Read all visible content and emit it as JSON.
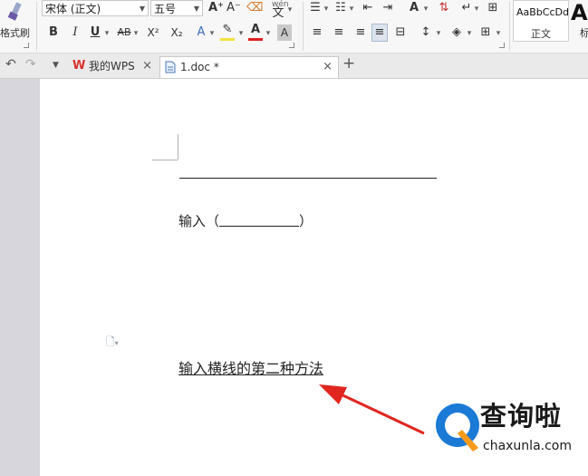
{
  "ribbon": {
    "format_painter_label": "格式刷",
    "font_name": "宋体 (正文)",
    "font_size": "五号",
    "grow_font": "A⁺",
    "shrink_font": "A⁻",
    "bold": "B",
    "italic": "I",
    "underline": "U",
    "strikethrough": "AB",
    "superscript": "X²",
    "subscript": "X₂",
    "pinyin_label": "wén",
    "style_preview": "AaBbCcDd",
    "style_name": "正文",
    "style2_preview": "A",
    "style2_name": "标"
  },
  "tabs": [
    {
      "label": "我的WPS",
      "close": "×"
    },
    {
      "label": "1.doc *",
      "close": "×"
    }
  ],
  "tabbar": {
    "new_tab": "+",
    "undo": "↶",
    "redo": "↷",
    "more": "▼"
  },
  "document": {
    "line1_prefix": "输入（",
    "line1_suffix": "）",
    "line2": "输入横线的第二种方法"
  },
  "watermark": {
    "cn": "查询啦",
    "en": "chaxunla.com"
  },
  "colors": {
    "wps_red": "#d9302c",
    "logo_blue": "#1a7ad6",
    "arrow_red": "#e0261f",
    "font_color_bar": "#e02020",
    "highlight_bar": "#f2e23c"
  }
}
